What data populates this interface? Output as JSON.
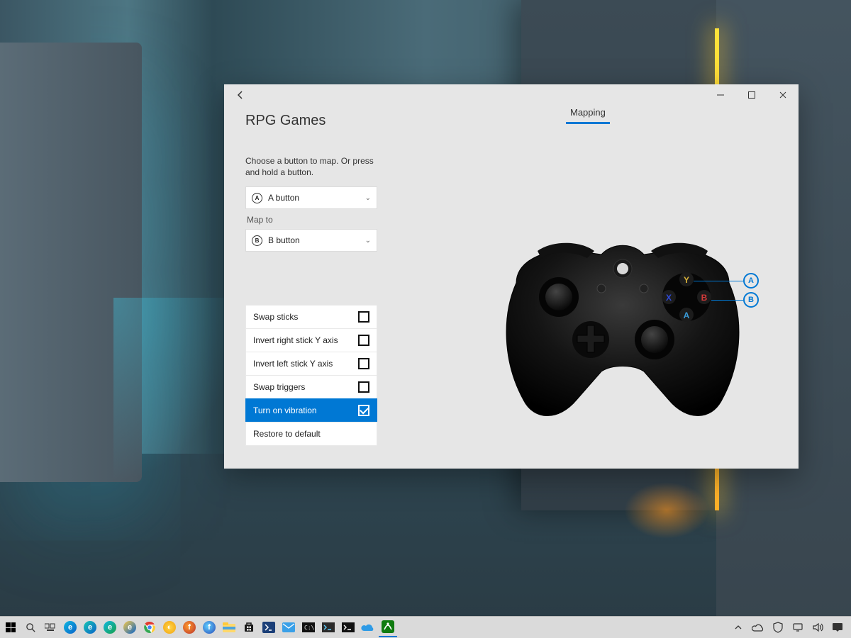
{
  "window": {
    "title": "RPG Games",
    "tab": "Mapping",
    "instructions": "Choose a button to map. Or press and hold a button.",
    "source": {
      "glyph": "A",
      "label": "A button"
    },
    "map_to_label": "Map to",
    "target": {
      "glyph": "B",
      "label": "B button"
    },
    "options": [
      {
        "label": "Swap sticks",
        "checked": false
      },
      {
        "label": "Invert right stick Y axis",
        "checked": false
      },
      {
        "label": "Invert left stick Y axis",
        "checked": false
      },
      {
        "label": "Swap triggers",
        "checked": false
      },
      {
        "label": "Turn on vibration",
        "checked": true
      }
    ],
    "restore": "Restore to default",
    "callouts": [
      {
        "letter": "A"
      },
      {
        "letter": "B"
      }
    ],
    "controller_buttons": {
      "Y": "Y",
      "X": "X",
      "B": "B",
      "A": "A"
    }
  }
}
